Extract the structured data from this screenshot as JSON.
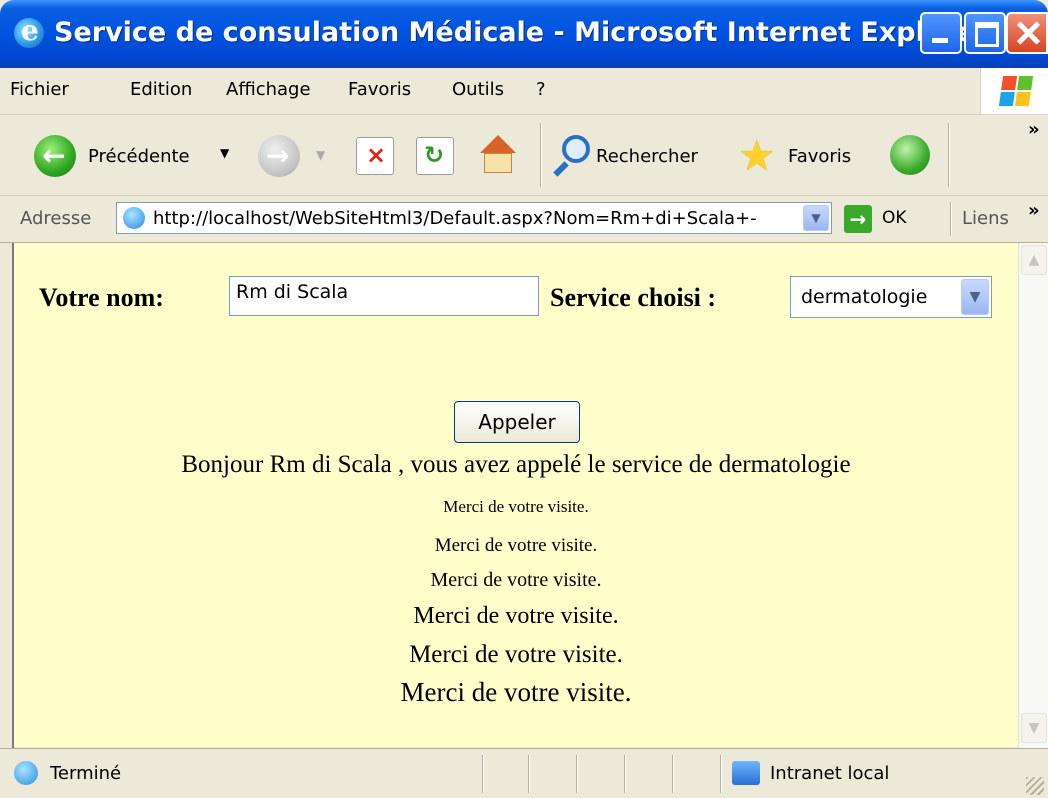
{
  "window": {
    "title": "Service de consulation Médicale - Microsoft Internet Explorer"
  },
  "menu": {
    "items": [
      "Fichier",
      "Edition",
      "Affichage",
      "Favoris",
      "Outils",
      "?"
    ]
  },
  "toolbar": {
    "back_label": "Précédente",
    "search_label": "Rechercher",
    "favorites_label": "Favoris",
    "more_symbol": "»"
  },
  "addressbar": {
    "label": "Adresse",
    "url": "http://localhost/WebSiteHtml3/Default.aspx?Nom=Rm+di+Scala+-",
    "go_label": "OK",
    "links_label": "Liens",
    "more_symbol": "»"
  },
  "page": {
    "name_label": "Votre nom:",
    "name_value": "Rm di Scala",
    "service_label": "Service choisi :",
    "service_selected": "dermatologie",
    "call_button": "Appeler",
    "greeting": "Bonjour Rm di Scala , vous avez appelé le service de dermatologie",
    "thanks": [
      "Merci de votre visite.",
      "Merci de votre visite.",
      "Merci de votre visite.",
      "Merci de votre visite.",
      "Merci de votre visite.",
      "Merci de votre visite."
    ]
  },
  "statusbar": {
    "status": "Terminé",
    "zone": "Intranet local"
  },
  "colors": {
    "page_background": "#ffffcc",
    "titlebar_blue": "#0054e3",
    "chrome": "#ece9d8"
  },
  "icons": [
    "ie-icon",
    "minimize-icon",
    "maximize-icon",
    "close-icon",
    "windows-logo-icon",
    "back-arrow-icon",
    "dropdown-caret-icon",
    "forward-arrow-icon",
    "stop-icon",
    "refresh-icon",
    "home-icon",
    "search-icon",
    "favorites-star-icon",
    "history-icon",
    "page-icon",
    "go-arrow-icon",
    "network-icon"
  ]
}
